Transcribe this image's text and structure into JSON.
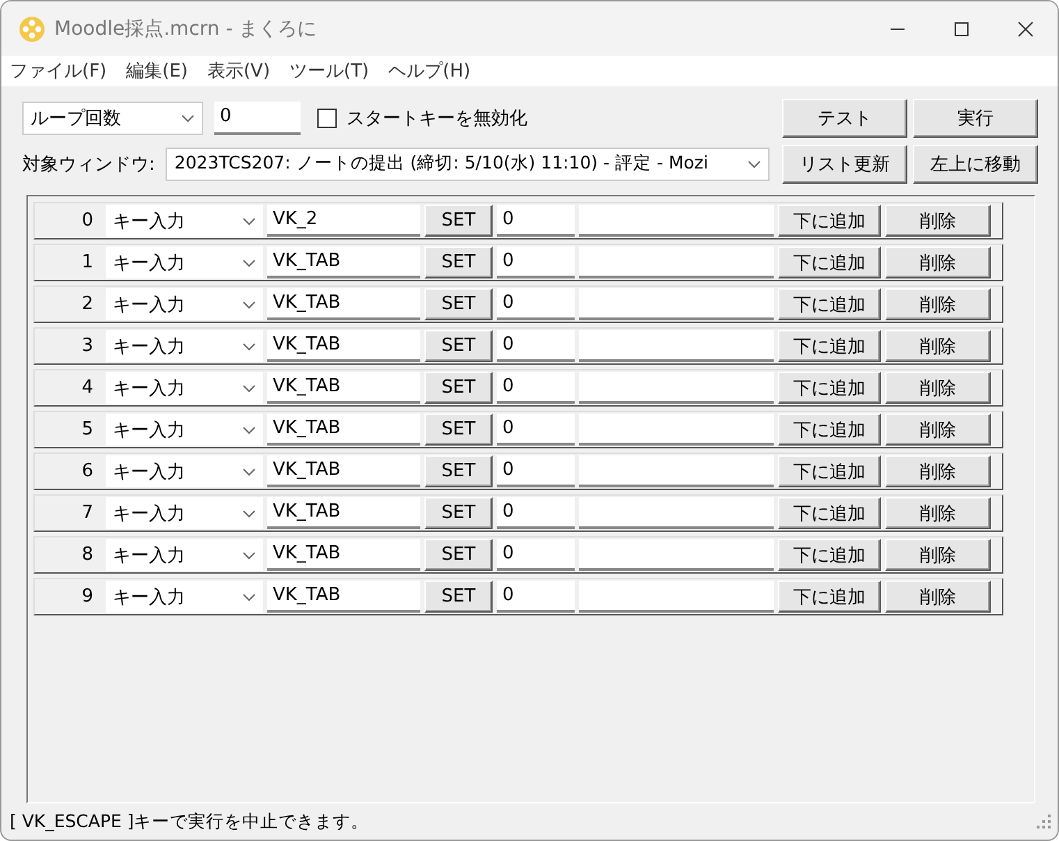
{
  "window": {
    "title": "Moodle採点.mcrn - まくろに"
  },
  "menu": [
    "ファイル(F)",
    "編集(E)",
    "表示(V)",
    "ツール(T)",
    "ヘルプ(H)"
  ],
  "toolbar": {
    "loop_mode": "ループ回数",
    "loop_count": "0",
    "disable_start_key": {
      "label": "スタートキーを無効化",
      "checked": false
    },
    "target_label": "対象ウィンドウ:",
    "target_window": "2023TCS207: ノートの提出 (締切: 5/10(水) 11:10) - 評定 - Mozi",
    "buttons": [
      "テスト",
      "実行",
      "リスト更新",
      "左上に移動"
    ]
  },
  "rows": [
    {
      "index": "0",
      "action": "キー入力",
      "key": "VK_2",
      "set": "SET",
      "value": "0",
      "add": "下に追加",
      "delete": "削除"
    },
    {
      "index": "1",
      "action": "キー入力",
      "key": "VK_TAB",
      "set": "SET",
      "value": "0",
      "add": "下に追加",
      "delete": "削除"
    },
    {
      "index": "2",
      "action": "キー入力",
      "key": "VK_TAB",
      "set": "SET",
      "value": "0",
      "add": "下に追加",
      "delete": "削除"
    },
    {
      "index": "3",
      "action": "キー入力",
      "key": "VK_TAB",
      "set": "SET",
      "value": "0",
      "add": "下に追加",
      "delete": "削除"
    },
    {
      "index": "4",
      "action": "キー入力",
      "key": "VK_TAB",
      "set": "SET",
      "value": "0",
      "add": "下に追加",
      "delete": "削除"
    },
    {
      "index": "5",
      "action": "キー入力",
      "key": "VK_TAB",
      "set": "SET",
      "value": "0",
      "add": "下に追加",
      "delete": "削除"
    },
    {
      "index": "6",
      "action": "キー入力",
      "key": "VK_TAB",
      "set": "SET",
      "value": "0",
      "add": "下に追加",
      "delete": "削除"
    },
    {
      "index": "7",
      "action": "キー入力",
      "key": "VK_TAB",
      "set": "SET",
      "value": "0",
      "add": "下に追加",
      "delete": "削除"
    },
    {
      "index": "8",
      "action": "キー入力",
      "key": "VK_TAB",
      "set": "SET",
      "value": "0",
      "add": "下に追加",
      "delete": "削除"
    },
    {
      "index": "9",
      "action": "キー入力",
      "key": "VK_TAB",
      "set": "SET",
      "value": "0",
      "add": "下に追加",
      "delete": "削除"
    }
  ],
  "status_bar": "[ VK_ESCAPE ]キーで実行を中止できます。"
}
